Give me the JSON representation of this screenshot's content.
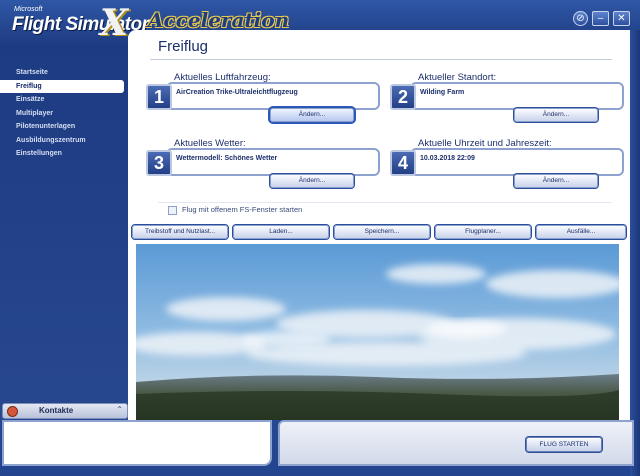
{
  "logo": {
    "microsoft": "Microsoft",
    "product": "Flight Simulator",
    "x_mark": "X",
    "edition": "Acceleration"
  },
  "window_buttons": [
    "sound",
    "minimize",
    "close"
  ],
  "sidebar": {
    "items": [
      {
        "label": "Startseite",
        "active": false
      },
      {
        "label": "Freiflug",
        "active": true
      },
      {
        "label": "Einsätze",
        "active": false
      },
      {
        "label": "Multiplayer",
        "active": false
      },
      {
        "label": "Pilotenunterlagen",
        "active": false
      },
      {
        "label": "Ausbildungszentrum",
        "active": false
      },
      {
        "label": "Einstellungen",
        "active": false
      }
    ],
    "contacts_label": "Kontakte"
  },
  "page": {
    "title": "Freiflug"
  },
  "panels": {
    "aircraft": {
      "number": "1",
      "title": "Aktuelles Luftfahrzeug:",
      "value": "AirCreation Trike-Ultraleichtflugzeug",
      "button": "Ändern..."
    },
    "location": {
      "number": "2",
      "title": "Aktueller Standort:",
      "value": "Wilding Farm",
      "button": "Ändern..."
    },
    "weather": {
      "number": "3",
      "title": "Aktuelles Wetter:",
      "value": "Wettermodell: Schönes Wetter",
      "button": "Ändern..."
    },
    "time": {
      "number": "4",
      "title": "Aktuelle Uhrzeit und Jahreszeit:",
      "value": "10.03.2018 22:09",
      "button": "Ändern..."
    }
  },
  "window_option": {
    "label": "Flug mit offenem FS-Fenster starten",
    "checked": false
  },
  "toolbar": {
    "fuel": "Treibstoff und Nutzlast...",
    "load": "Laden...",
    "save": "Speichern...",
    "planner": "Flugplaner...",
    "failures": "Ausfälle..."
  },
  "footer": {
    "start_label": "FLUG STARTEN"
  },
  "colors": {
    "accent": "#2a4f9a",
    "panel_text": "#1c2f6a",
    "logo_gold": "#e9c94a"
  }
}
